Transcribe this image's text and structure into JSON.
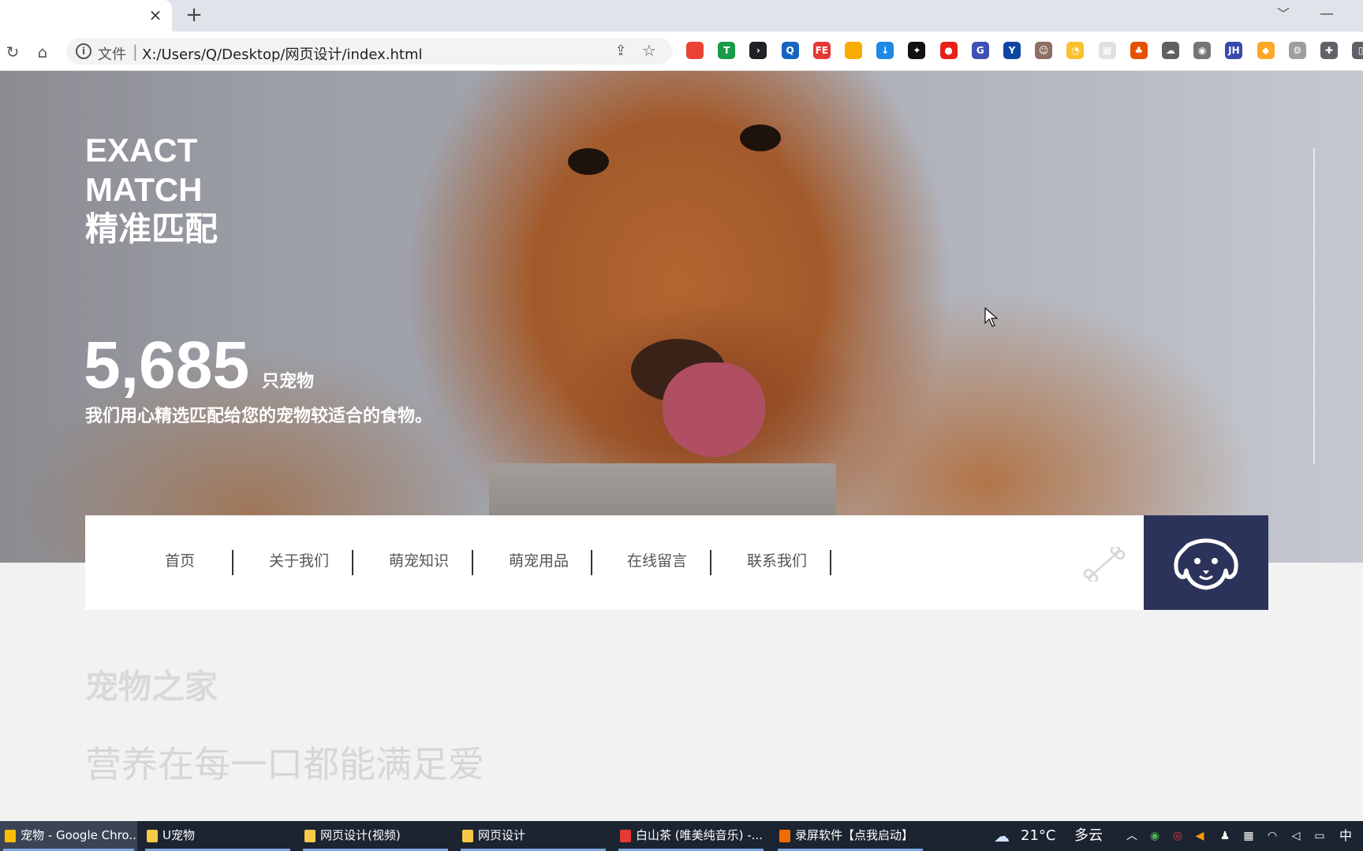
{
  "browser": {
    "tab_close": "×",
    "new_tab": "+",
    "address_scheme": "文件",
    "address_sep": "|",
    "address_url": "X:/Users/Q/Desktop/网页设计/index.html",
    "info_glyph": "i"
  },
  "extensions": [
    {
      "name": "chrome-ext",
      "color": "#ea4335",
      "glyph": ""
    },
    {
      "name": "shield-ext",
      "color": "#1a9b47",
      "glyph": "T"
    },
    {
      "name": "dark-ext",
      "color": "#202124",
      "glyph": "›"
    },
    {
      "name": "search-ext",
      "color": "#1565c0",
      "glyph": "Q"
    },
    {
      "name": "fe-ext",
      "color": "#e53935",
      "glyph": "FE"
    },
    {
      "name": "chrome2-ext",
      "color": "#f9ab00",
      "glyph": ""
    },
    {
      "name": "download-ext",
      "color": "#1e88e5",
      "glyph": "↓"
    },
    {
      "name": "openai-ext",
      "color": "#111111",
      "glyph": "✦"
    },
    {
      "name": "red-ext",
      "color": "#e62117",
      "glyph": "●"
    },
    {
      "name": "g-ext",
      "color": "#3f51b5",
      "glyph": "G"
    },
    {
      "name": "y-ext",
      "color": "#0d47a1",
      "glyph": "Y"
    },
    {
      "name": "face-ext",
      "color": "#8d6e63",
      "glyph": "☺"
    },
    {
      "name": "yellow-ext",
      "color": "#fbc02d",
      "glyph": "◔"
    },
    {
      "name": "grid-ext",
      "color": "#e0e0e0",
      "glyph": "▦"
    },
    {
      "name": "tree-ext",
      "color": "#e65100",
      "glyph": "♣"
    },
    {
      "name": "cloud-ext",
      "color": "#616161",
      "glyph": "☁"
    },
    {
      "name": "camera-ext",
      "color": "#757575",
      "glyph": "◉"
    },
    {
      "name": "jh-ext",
      "color": "#3949ab",
      "glyph": "JH"
    },
    {
      "name": "orange-ext",
      "color": "#ffa726",
      "glyph": "◆"
    },
    {
      "name": "gear-ext",
      "color": "#9e9e9e",
      "glyph": "⚙"
    },
    {
      "name": "puzzle-ext",
      "color": "#5f6368",
      "glyph": "✚"
    },
    {
      "name": "sidepanel-ext",
      "color": "#5f6368",
      "glyph": "▯"
    }
  ],
  "hero": {
    "title_line1": "EXACT",
    "title_line2": "MATCH",
    "title_line3": "精准匹配",
    "count": "5,685",
    "count_unit": "只宠物",
    "slogan": "我们用心精选匹配给您的宠物较适合的食物。"
  },
  "nav": {
    "items": [
      "首页",
      "关于我们",
      "萌宠知识",
      "萌宠用品",
      "在线留言",
      "联系我们"
    ]
  },
  "section": {
    "title": "宠物之家",
    "subtitle": "营养在每一口都能满足爱"
  },
  "taskbar": {
    "items": [
      {
        "label": "宠物 - Google Chro...",
        "icon_color": "#fbbc05",
        "active": true
      },
      {
        "label": "U宠物",
        "icon_color": "#f7c948",
        "active": false
      },
      {
        "label": "网页设计(视频)",
        "icon_color": "#f7c948",
        "active": false
      },
      {
        "label": "网页设计",
        "icon_color": "#f7c948",
        "active": false
      },
      {
        "label": "白山茶 (唯美纯音乐) -...",
        "icon_color": "#e53935",
        "active": false
      },
      {
        "label": "录屏软件【点我启动】",
        "icon_color": "#ef6c00",
        "active": false
      }
    ],
    "weather_temp": "21°C",
    "weather_text": "多云",
    "ime": "中"
  }
}
